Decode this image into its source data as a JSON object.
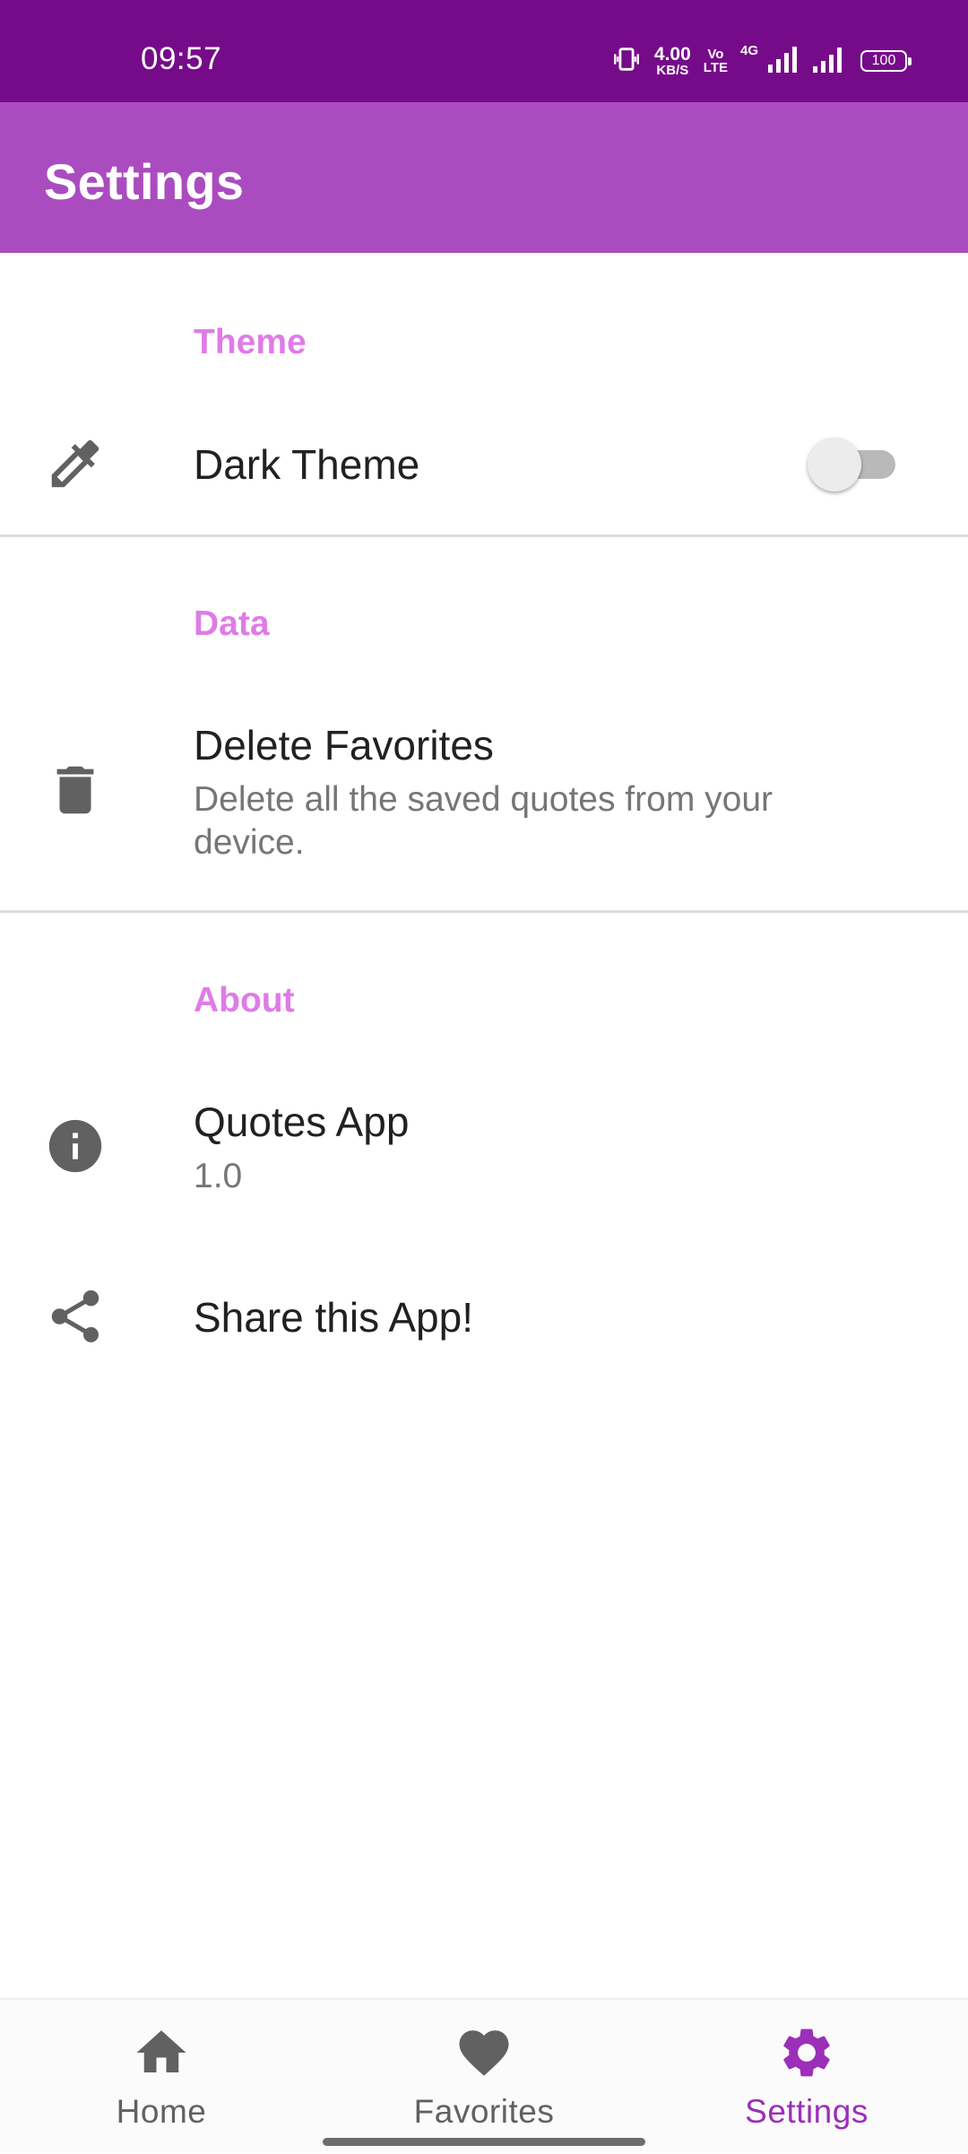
{
  "status_bar": {
    "time": "09:57",
    "net_speed_value": "4.00",
    "net_speed_unit": "KB/S",
    "volte_top": "Vo",
    "volte_bottom": "LTE",
    "network_type": "4G",
    "battery": "100",
    "background_color": "#760b89"
  },
  "app_bar": {
    "title": "Settings",
    "background_color": "#aa4cbf"
  },
  "sections": {
    "theme": {
      "header": "Theme",
      "dark_theme": {
        "icon": "eyedropper-icon",
        "title": "Dark Theme",
        "enabled": false
      }
    },
    "data": {
      "header": "Data",
      "delete_favorites": {
        "icon": "trash-icon",
        "title": "Delete Favorites",
        "summary": "Delete all the saved quotes from your device."
      }
    },
    "about": {
      "header": "About",
      "app_info": {
        "icon": "info-icon",
        "title": "Quotes App",
        "summary": "1.0"
      },
      "share": {
        "icon": "share-icon",
        "title": "Share this App!"
      }
    }
  },
  "bottom_nav": {
    "items": [
      {
        "label": "Home",
        "icon": "home-icon",
        "active": false
      },
      {
        "label": "Favorites",
        "icon": "heart-icon",
        "active": false
      },
      {
        "label": "Settings",
        "icon": "gear-icon",
        "active": true
      }
    ],
    "active_color": "#9c2fb8",
    "inactive_color": "#616161"
  },
  "colors": {
    "section_header": "#df7be8",
    "icon": "#616161"
  }
}
